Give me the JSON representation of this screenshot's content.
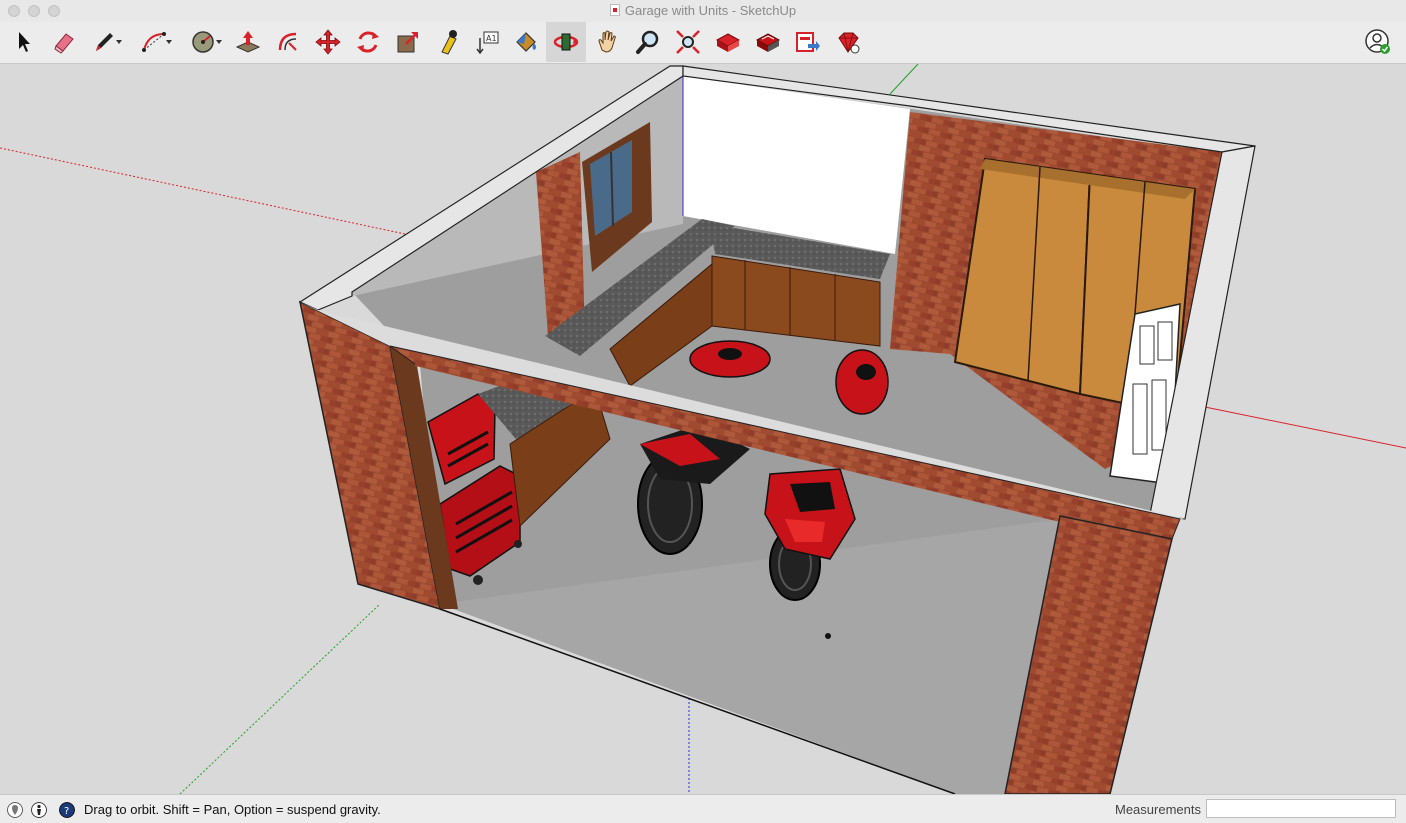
{
  "window": {
    "title": "Garage with Units - SketchUp"
  },
  "toolbar": {
    "tools": [
      {
        "name": "select-icon"
      },
      {
        "name": "eraser-icon"
      },
      {
        "name": "pencil-icon"
      },
      {
        "name": "arc-icon"
      },
      {
        "name": "shapes-icon"
      },
      {
        "name": "push-pull-icon"
      },
      {
        "name": "offset-icon"
      },
      {
        "name": "move-icon"
      },
      {
        "name": "rotate-icon"
      },
      {
        "name": "scale-icon"
      },
      {
        "name": "tape-measure-icon"
      },
      {
        "name": "text-icon"
      },
      {
        "name": "paint-bucket-icon"
      },
      {
        "name": "orbit-icon"
      },
      {
        "name": "pan-icon"
      },
      {
        "name": "zoom-icon"
      },
      {
        "name": "zoom-extents-icon"
      },
      {
        "name": "warehouse-icon"
      },
      {
        "name": "extension-warehouse-icon"
      },
      {
        "name": "send-to-layout-icon"
      },
      {
        "name": "ruby-extension-icon"
      }
    ],
    "active_tool": "orbit-icon"
  },
  "colors": {
    "axis_red": "#d8222a",
    "axis_green": "#1fa21f",
    "axis_blue": "#2a2ad8",
    "brick": "#9a4a32",
    "floor": "#9c9c9c",
    "wall_top": "#e6e6e6",
    "sky": "#d9d9d9",
    "cabinet": "#8a4a1e",
    "wardrobe": "#c98a3e",
    "toolbox_red": "#c8121a"
  },
  "status": {
    "hint": "Drag to orbit. Shift = Pan, Option = suspend gravity.",
    "measurements_label": "Measurements",
    "measurements_value": ""
  }
}
